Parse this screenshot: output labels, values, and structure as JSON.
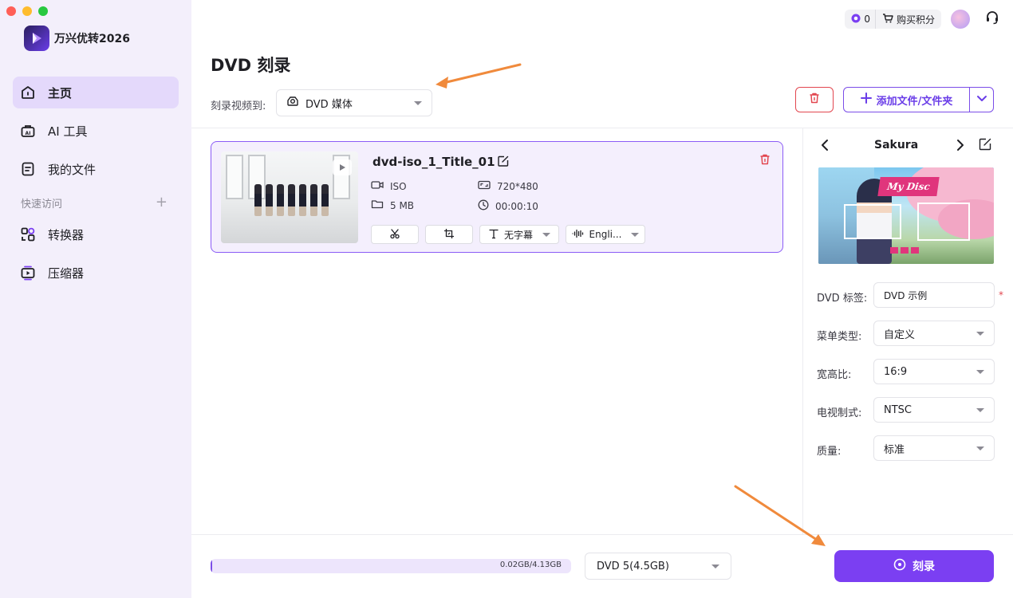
{
  "app": {
    "name": "万兴优转2026"
  },
  "sidebar": {
    "items": [
      {
        "label": "主页",
        "icon": "home-icon"
      },
      {
        "label": "AI 工具",
        "icon": "ai-toolbox-icon"
      },
      {
        "label": "我的文件",
        "icon": "file-icon"
      }
    ],
    "quick_access_label": "快速访问",
    "quick_items": [
      {
        "label": "转换器",
        "icon": "converter-icon"
      },
      {
        "label": "压缩器",
        "icon": "compressor-icon"
      }
    ]
  },
  "topbar": {
    "credits": "0",
    "buy_label": "购买积分"
  },
  "page": {
    "title": "DVD 刻录",
    "burn_to_label": "刻录视频到:",
    "burn_target": "DVD 媒体",
    "add_files_label": "添加文件/文件夹"
  },
  "file": {
    "title": "dvd-iso_1_Title_01",
    "format": "ISO",
    "size": "5 MB",
    "resolution": "720*480",
    "duration": "00:00:10",
    "subtitle": "无字幕",
    "audio": "Engli..."
  },
  "template_panel": {
    "name": "Sakura",
    "preview_text": "My Disc",
    "dvd_label_label": "DVD 标签:",
    "dvd_label_value": "DVD 示例",
    "menu_type_label": "菜单类型:",
    "menu_type_value": "自定义",
    "aspect_label": "宽高比:",
    "aspect_value": "16:9",
    "tv_label": "电视制式:",
    "tv_value": "NTSC",
    "quality_label": "质量:",
    "quality_value": "标准",
    "required_mark": "*"
  },
  "footer": {
    "usage_text": "0.02GB/4.13GB",
    "usage_fraction": 0.005,
    "disc_type": "DVD 5(4.5GB)",
    "burn_label": "刻录"
  },
  "colors": {
    "accent": "#7b3ff2",
    "danger": "#e2464f",
    "annotation": "#f08a3c"
  }
}
